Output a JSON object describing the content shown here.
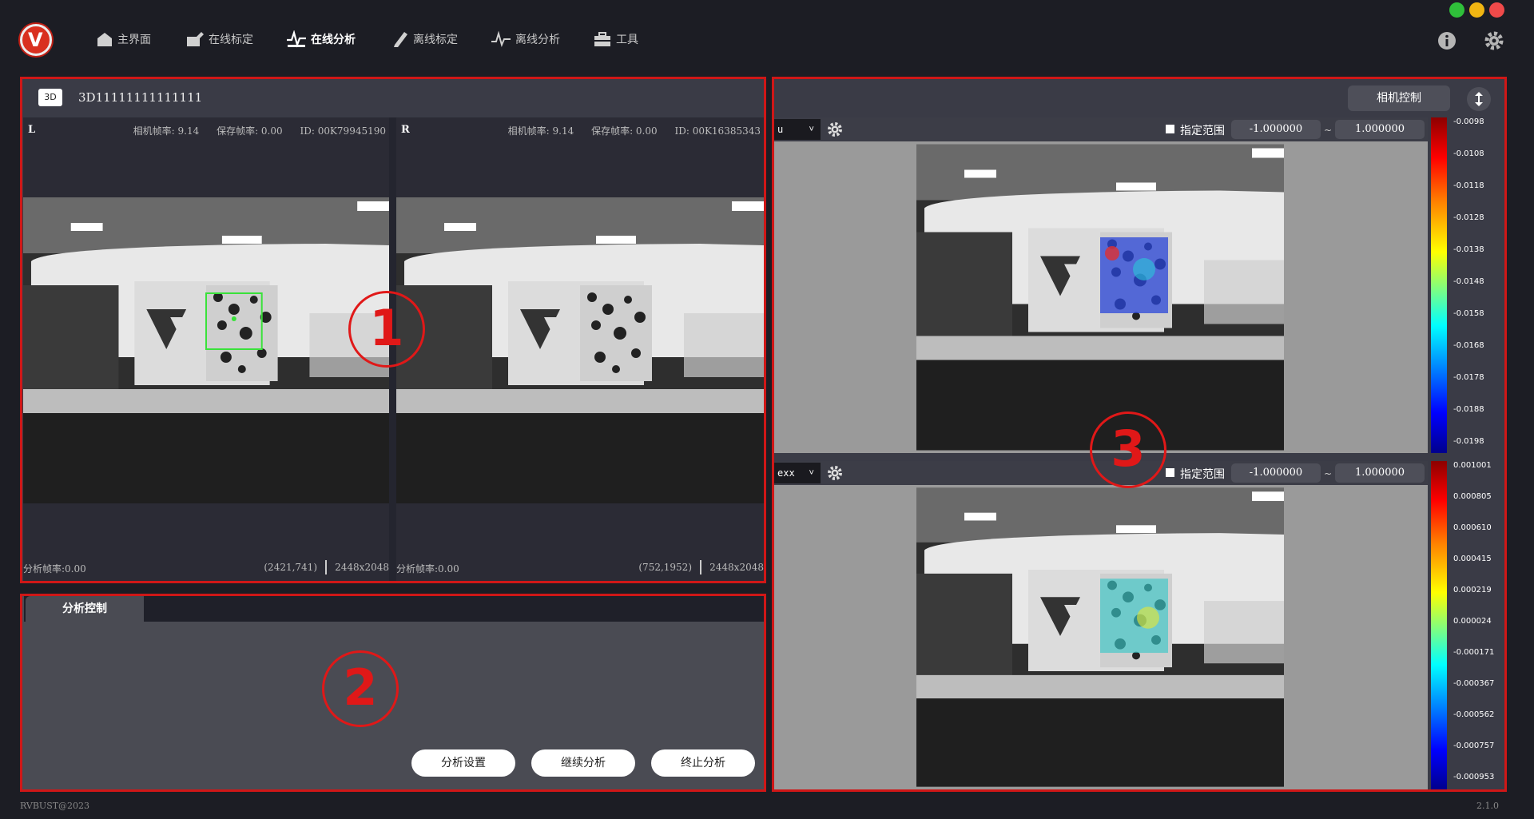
{
  "nav": {
    "items": [
      {
        "label": "主界面",
        "icon": "home-icon"
      },
      {
        "label": "在线标定",
        "icon": "edit-icon"
      },
      {
        "label": "在线分析",
        "icon": "pulse-icon"
      },
      {
        "label": "离线标定",
        "icon": "pen-icon"
      },
      {
        "label": "离线分析",
        "icon": "wave-icon"
      },
      {
        "label": "工具",
        "icon": "toolbox-icon"
      }
    ],
    "active": "在线分析"
  },
  "window": {
    "colors": {
      "green": "#2fbf3a",
      "yellow": "#f0b512",
      "red": "#ef4a4a"
    }
  },
  "panel1": {
    "badge": "3D",
    "device_name": "3D11111111111111",
    "annotation": "1",
    "left": {
      "side": "L",
      "fps_text": "相机帧率: 9.14",
      "save_text": "保存帧率: 0.00",
      "id_text": "ID: 00K79945190",
      "rate_text": "分析帧率:0.00",
      "coord_text": "(2421,741)",
      "res_text": "2448x2048"
    },
    "right": {
      "side": "R",
      "fps_text": "相机帧率: 9.14",
      "save_text": "保存帧率: 0.00",
      "id_text": "ID: 00K16385343",
      "rate_text": "分析帧率:0.00",
      "coord_text": "(752,1952)",
      "res_text": "2448x2048"
    }
  },
  "panel2": {
    "tab": "分析控制",
    "annotation": "2",
    "buttons": [
      "分析设置",
      "继续分析",
      "终止分析"
    ]
  },
  "panel3": {
    "camera_control": "相机控制",
    "annotation": "3",
    "views": [
      {
        "select": "u",
        "range_label": "指定范围",
        "min": "-1.000000",
        "tilde": "~",
        "max": "1.000000",
        "colorbar": [
          "-0.0098",
          "-0.0108",
          "-0.0118",
          "-0.0128",
          "-0.0138",
          "-0.0148",
          "-0.0158",
          "-0.0168",
          "-0.0178",
          "-0.0188",
          "-0.0198"
        ]
      },
      {
        "select": "exx",
        "range_label": "指定范围",
        "min": "-1.000000",
        "tilde": "~",
        "max": "1.000000",
        "colorbar": [
          "0.001001",
          "0.000805",
          "0.000610",
          "0.000415",
          "0.000219",
          "0.000024",
          "-0.000171",
          "-0.000367",
          "-0.000562",
          "-0.000757",
          "-0.000953"
        ]
      }
    ]
  },
  "footer": {
    "copyright": "RVBUST@2023",
    "version": "2.1.0"
  }
}
